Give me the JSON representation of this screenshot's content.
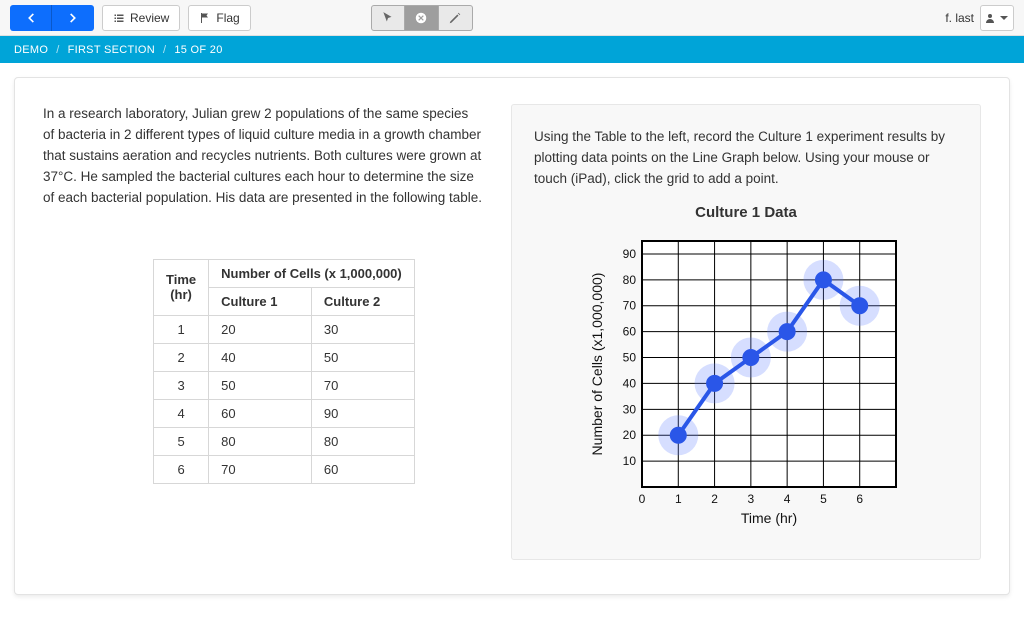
{
  "topbar": {
    "review_label": "Review",
    "flag_label": "Flag",
    "user_name": "f. last"
  },
  "breadcrumb": {
    "a": "DEMO",
    "b": "FIRST SECTION",
    "c": "15 OF 20"
  },
  "prompt_text": "In a research laboratory, Julian grew 2 populations of the same species of bacteria in 2 different types of liquid culture media in a growth chamber that sustains aeration and recycles nutrients. Both cultures were grown at 37°C. He sampled the bacterial cultures each hour to determine the size of each bacterial population. His data are presented in the following table.",
  "table": {
    "time_header": "Time (hr)",
    "cells_header": "Number of Cells (x 1,000,000)",
    "col1": "Culture 1",
    "col2": "Culture 2",
    "rows": [
      {
        "t": "1",
        "c1": "20",
        "c2": "30"
      },
      {
        "t": "2",
        "c1": "40",
        "c2": "50"
      },
      {
        "t": "3",
        "c1": "50",
        "c2": "70"
      },
      {
        "t": "4",
        "c1": "60",
        "c2": "90"
      },
      {
        "t": "5",
        "c1": "80",
        "c2": "80"
      },
      {
        "t": "6",
        "c1": "70",
        "c2": "60"
      }
    ]
  },
  "instructions_text": "Using the Table to the left, record the Culture 1 experiment results by plotting data points on the Line Graph below. Using your mouse or touch (iPad), click the grid to add a point.",
  "chart_title": "Culture 1 Data",
  "chart_data": {
    "type": "line",
    "title": "Culture 1 Data",
    "xlabel": "Time (hr)",
    "ylabel": "Number of Cells (x1,000,000)",
    "x_ticks": [
      0,
      1,
      2,
      3,
      4,
      5,
      6
    ],
    "y_ticks": [
      10,
      20,
      30,
      40,
      50,
      60,
      70,
      80,
      90
    ],
    "x": [
      1,
      2,
      3,
      4,
      5,
      6
    ],
    "values": [
      20,
      40,
      50,
      60,
      80,
      70
    ],
    "xlim": [
      0,
      7
    ],
    "ylim": [
      0,
      95
    ]
  }
}
